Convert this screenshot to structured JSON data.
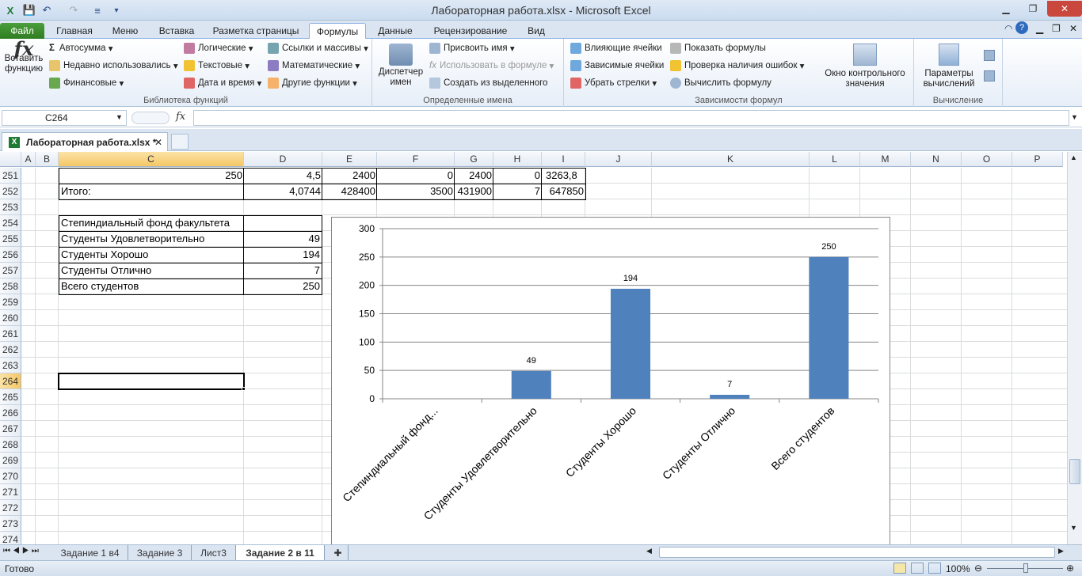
{
  "window": {
    "title": "Лабораторная работа.xlsx  -  Microsoft Excel"
  },
  "ribbon_tabs": [
    "Файл",
    "Главная",
    "Меню",
    "Вставка",
    "Разметка страницы",
    "Формулы",
    "Данные",
    "Рецензирование",
    "Вид"
  ],
  "ribbon": {
    "insert_function": "Вставить функцию",
    "autosum": "Автосумма",
    "recent": "Недавно использовались",
    "financial": "Финансовые",
    "logical": "Логические",
    "text": "Текстовые",
    "datetime": "Дата и время",
    "lookup": "Ссылки и массивы",
    "math": "Математические",
    "other": "Другие функции",
    "group_library": "Библиотека функций",
    "name_manager": "Диспетчер имен",
    "define_name": "Присвоить имя",
    "use_in_formula": "Использовать в формуле",
    "create_from_selection": "Создать из выделенного",
    "group_names": "Определенные имена",
    "trace_precedents": "Влияющие ячейки",
    "trace_dependents": "Зависимые ячейки",
    "remove_arrows": "Убрать стрелки",
    "show_formulas": "Показать формулы",
    "error_checking": "Проверка наличия ошибок",
    "evaluate_formula": "Вычислить формулу",
    "group_auditing": "Зависимости формул",
    "watch_window": "Окно контрольного значения",
    "calc_options": "Параметры вычислений",
    "group_calc": "Вычисление"
  },
  "formula_bar": {
    "name_box": "C264",
    "fx": "fx",
    "formula": ""
  },
  "workbook_tab": "Лабораторная работа.xlsx *",
  "columns": [
    "A",
    "B",
    "C",
    "D",
    "E",
    "F",
    "G",
    "H",
    "I",
    "J",
    "K",
    "L",
    "M",
    "N",
    "O",
    "P"
  ],
  "rows": [
    "251",
    "252",
    "253",
    "254",
    "255",
    "256",
    "257",
    "258",
    "259",
    "260",
    "261",
    "262",
    "263",
    "264",
    "265",
    "266",
    "267",
    "268",
    "269",
    "270",
    "271",
    "272",
    "273",
    "274"
  ],
  "cells": {
    "r251": {
      "C": "250",
      "D": "4,5",
      "E": "2400",
      "F": "0",
      "G": "2400",
      "H": "0",
      "I": "3263,8"
    },
    "r252": {
      "C": "Итого:",
      "D": "4,0744",
      "E": "428400",
      "F": "3500",
      "G": "431900",
      "H": "7",
      "I": "647850"
    },
    "summary": [
      {
        "label": "Степиндиальный фонд факультета",
        "value": ""
      },
      {
        "label": "Студенты Удовлетворительно",
        "value": "49"
      },
      {
        "label": "Студенты Хорошо",
        "value": "194"
      },
      {
        "label": "Студенты Отлично",
        "value": "7"
      },
      {
        "label": "Всего студентов",
        "value": "250"
      }
    ]
  },
  "chart_data": {
    "type": "bar",
    "categories": [
      "Степиндиальный  фонд...",
      "Студенты Удовлетворительно",
      "Студенты Хорошо",
      "Студенты Отлично",
      "Всего студентов"
    ],
    "values": [
      0,
      49,
      194,
      7,
      250
    ],
    "data_labels": [
      "",
      "49",
      "194",
      "7",
      "250"
    ],
    "yticks": [
      "0",
      "50",
      "100",
      "150",
      "200",
      "250",
      "300"
    ],
    "ylim": [
      0,
      300
    ],
    "bar_color": "#4f81bd",
    "grid": true,
    "title": "",
    "xlabel": "",
    "ylabel": ""
  },
  "sheet_tabs": [
    "Задание 1 в4",
    "Задание 3",
    "Лист3",
    "Задание 2 в 11"
  ],
  "active_sheet": "Задание 2 в 11",
  "status": {
    "ready": "Готово",
    "zoom": "100%"
  }
}
